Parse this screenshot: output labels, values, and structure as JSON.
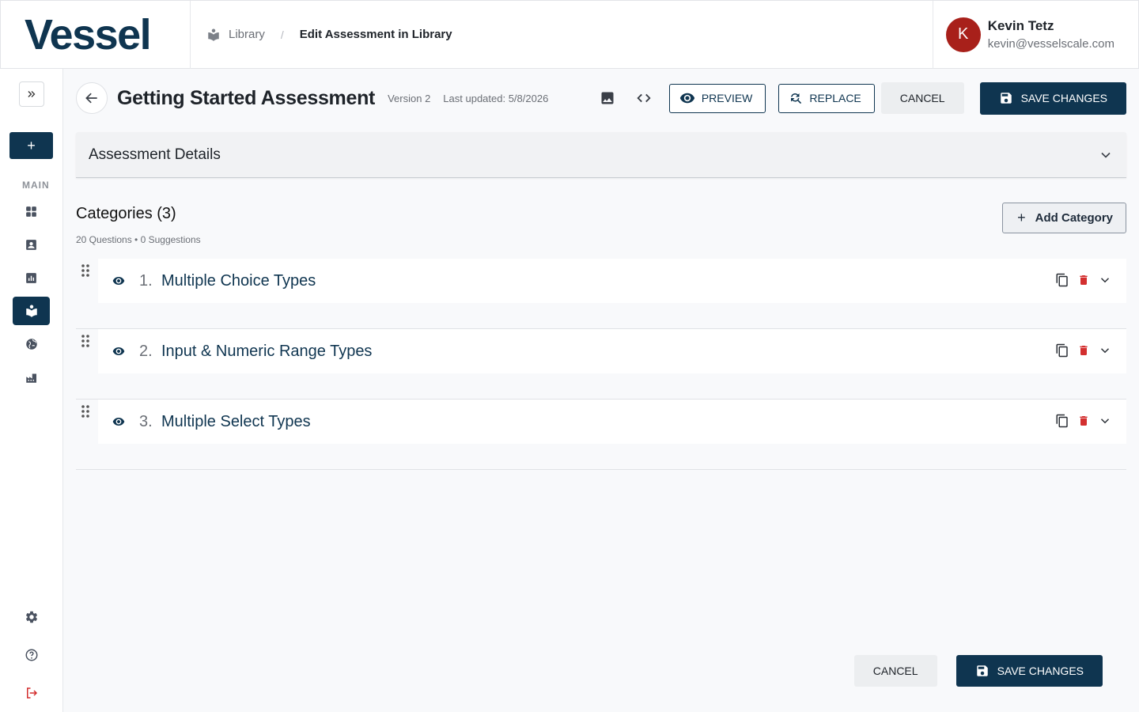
{
  "brand": {
    "logo_text": "Vessel",
    "color": "#0f3550"
  },
  "breadcrumb": {
    "icon": "library-icon",
    "link": "Library",
    "separator": "/",
    "current": "Edit Assessment in Library"
  },
  "user": {
    "initial": "K",
    "name": "Kevin Tetz",
    "email": "kevin@vesselscale.com",
    "avatar_color": "#a8201a"
  },
  "sidebar": {
    "add_label": "+",
    "section_label": "MAIN",
    "items": [
      {
        "icon": "dashboard-icon",
        "active": false
      },
      {
        "icon": "contacts-icon",
        "active": false
      },
      {
        "icon": "reports-icon",
        "active": false
      },
      {
        "icon": "library-icon",
        "active": true
      },
      {
        "icon": "globe-icon",
        "active": false
      },
      {
        "icon": "factory-icon",
        "active": false
      }
    ],
    "bottom_items": [
      {
        "icon": "gear-icon"
      },
      {
        "icon": "help-icon"
      },
      {
        "icon": "logout-icon"
      }
    ]
  },
  "page": {
    "title": "Getting Started Assessment",
    "version": "Version 2",
    "last_updated": "Last updated: 5/8/2026"
  },
  "toolbar": {
    "preview_label": "PREVIEW",
    "replace_label": "REPLACE",
    "cancel_label": "CANCEL",
    "save_label": "SAVE CHANGES"
  },
  "details": {
    "title": "Assessment Details"
  },
  "categories": {
    "title": "Categories (3)",
    "summary": "20 Questions • 0 Suggestions",
    "add_label": "Add Category",
    "items": [
      {
        "number": "1.",
        "name": "Multiple Choice Types"
      },
      {
        "number": "2.",
        "name": "Input & Numeric Range Types"
      },
      {
        "number": "3.",
        "name": "Multiple Select Types"
      }
    ]
  },
  "footer": {
    "cancel_label": "CANCEL",
    "save_label": "SAVE CHANGES"
  },
  "colors": {
    "primary": "#0f3550",
    "danger": "#d32f2f",
    "background": "#f8f9fb"
  }
}
